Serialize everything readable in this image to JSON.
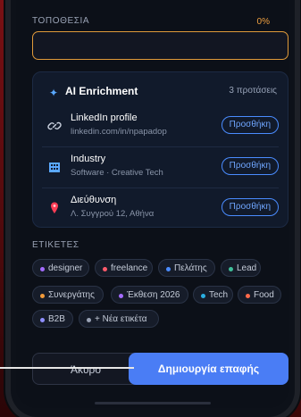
{
  "form": {
    "location_label": "ΤΟΠΟΘΕΣΙΑ",
    "location_percent": "0%",
    "location_value": ""
  },
  "ai": {
    "title": "AI Enrichment",
    "count": "3 προτάσεις",
    "icon": "sparkles-icon",
    "rows": [
      {
        "icon": "link-icon",
        "title": "LinkedIn profile",
        "subtitle": "linkedin.com/in/npapadop",
        "action": "Προσθήκη"
      },
      {
        "icon": "building-icon",
        "title": "Industry",
        "subtitle": "Software · Creative Tech",
        "action": "Προσθήκη"
      },
      {
        "icon": "map-pin-icon",
        "title": "Διεύθυνση",
        "subtitle": "Λ. Συγγρού 12, Αθήνα",
        "action": "Προσθήκη"
      }
    ]
  },
  "tags": {
    "label": "ΕΤΙΚΕΤΕΣ",
    "items": [
      {
        "label": "designer",
        "color": "#a46cff"
      },
      {
        "label": "freelance",
        "color": "#ff5b6b"
      },
      {
        "label": "Πελάτης",
        "color": "#4a8cff"
      },
      {
        "label": "Lead",
        "color": "#3fbf9a"
      },
      {
        "label": "Συνεργάτης",
        "color": "#f29a3a"
      },
      {
        "label": "Έκθεση 2026",
        "color": "#a46cff"
      },
      {
        "label": "Tech",
        "color": "#2aaee0"
      },
      {
        "label": "Food",
        "color": "#ff6a4a"
      },
      {
        "label": "B2B",
        "color": "#8f8fff"
      },
      {
        "label": "+ Νέα ετικέτα",
        "color": "#9aa3b5"
      }
    ]
  },
  "actions": {
    "cancel": "Άκυρο",
    "create": "Δημιουργία επαφής"
  }
}
